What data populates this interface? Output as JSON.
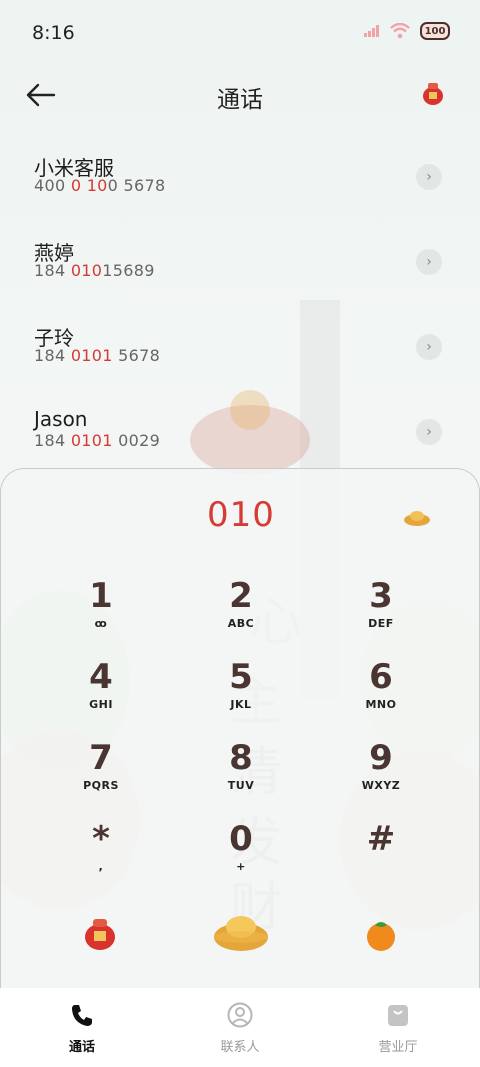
{
  "status": {
    "time": "8:16",
    "battery": "100"
  },
  "header": {
    "title": "通话"
  },
  "contacts": [
    {
      "name": "小米客服",
      "num_pre": "400 ",
      "num_hl": "0 10",
      "num_post": "0 5678"
    },
    {
      "name": "燕婷",
      "num_pre": "184 ",
      "num_hl": "010",
      "num_post": "15689"
    },
    {
      "name": "子玲",
      "num_pre": "184 ",
      "num_hl": "0101",
      "num_post": " 5678"
    },
    {
      "name": "Jason",
      "num_pre": "184 ",
      "num_hl": "0101",
      "num_post": " 0029"
    }
  ],
  "dialpad": {
    "input": "010",
    "keys": [
      {
        "digit": "1",
        "sub": "ꝏ"
      },
      {
        "digit": "2",
        "sub": "ABC"
      },
      {
        "digit": "3",
        "sub": "DEF"
      },
      {
        "digit": "4",
        "sub": "GHI"
      },
      {
        "digit": "5",
        "sub": "JKL"
      },
      {
        "digit": "6",
        "sub": "MNO"
      },
      {
        "digit": "7",
        "sub": "PQRS"
      },
      {
        "digit": "8",
        "sub": "TUV"
      },
      {
        "digit": "9",
        "sub": "WXYZ"
      },
      {
        "digit": "*",
        "sub": ","
      },
      {
        "digit": "0",
        "sub": "+"
      },
      {
        "digit": "#",
        "sub": ""
      }
    ]
  },
  "tabs": [
    {
      "label": "通话",
      "icon": "phone-icon"
    },
    {
      "label": "联系人",
      "icon": "person-icon"
    },
    {
      "label": "营业厅",
      "icon": "bag-icon"
    }
  ],
  "colors": {
    "accent": "#d63b35",
    "digit": "#4a3532"
  }
}
